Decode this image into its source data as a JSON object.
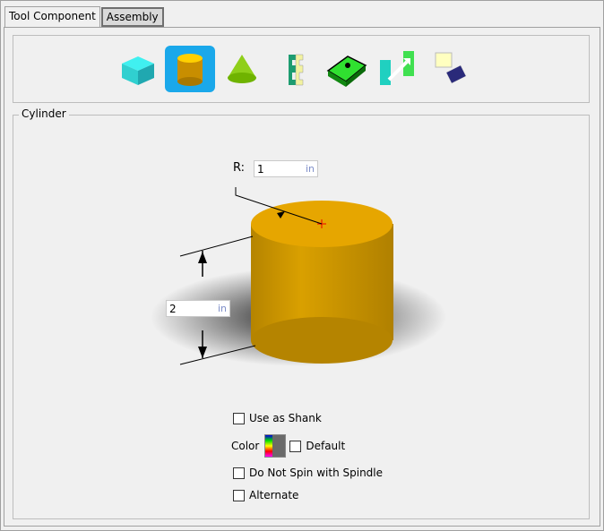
{
  "tabs": [
    {
      "label": "Tool Component",
      "active": true
    },
    {
      "label": "Assembly",
      "active": false
    }
  ],
  "toolbar": {
    "buttons": [
      {
        "icon": "box-icon",
        "selected": false
      },
      {
        "icon": "cylinder-icon",
        "selected": true
      },
      {
        "icon": "cone-icon",
        "selected": false
      },
      {
        "icon": "profile-icon",
        "selected": false
      },
      {
        "icon": "mesh-icon",
        "selected": false
      },
      {
        "icon": "extrude-icon",
        "selected": false
      },
      {
        "icon": "assembly-icon",
        "selected": false
      }
    ]
  },
  "cylinder": {
    "title": "Cylinder",
    "radius_label": "R:",
    "radius_value": "1",
    "radius_unit": "in",
    "height_value": "2",
    "height_unit": "in",
    "body_color": "#d9a000",
    "top_color": "#e6a600"
  },
  "options": {
    "use_as_shank": "Use as Shank",
    "color_label": "Color",
    "default_label": "Default",
    "no_spin": "Do Not Spin with Spindle",
    "alternate": "Alternate"
  }
}
